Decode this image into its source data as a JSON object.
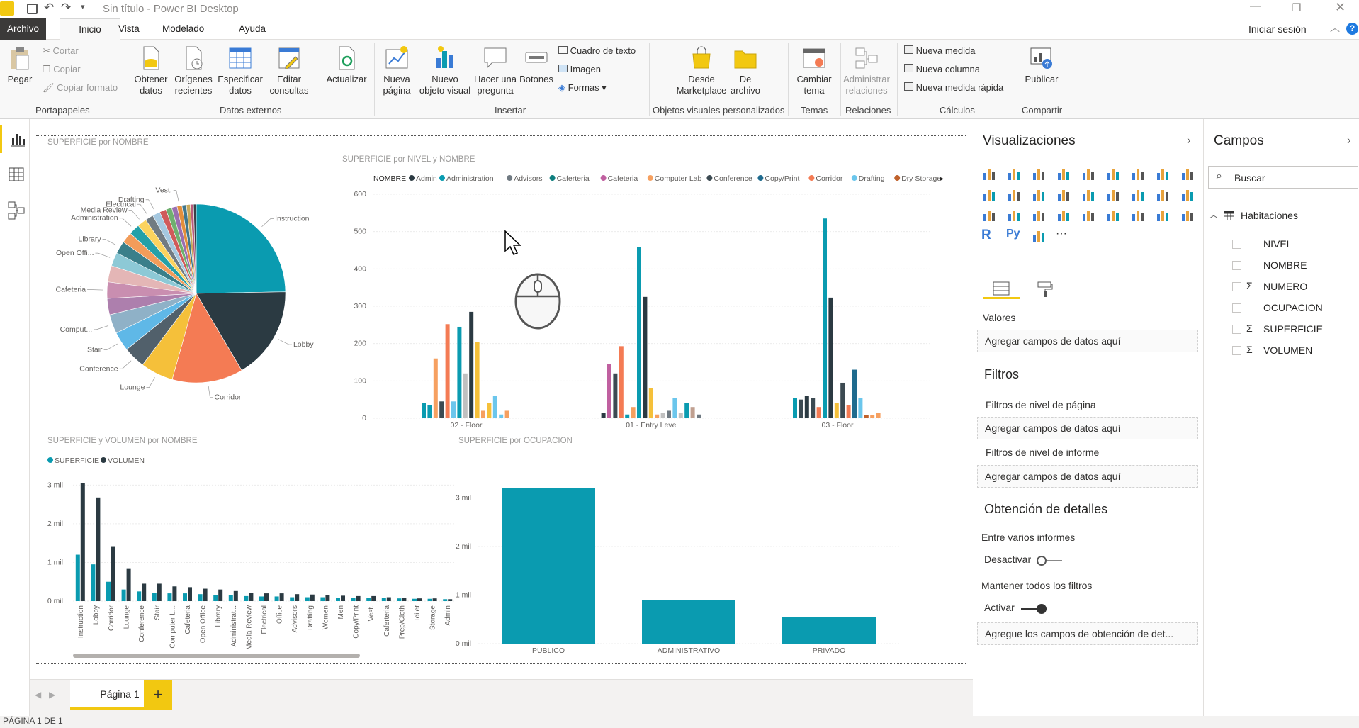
{
  "window": {
    "title": "Sin título - Power BI Desktop"
  },
  "ribbon_tabs": [
    {
      "label": "Archivo"
    },
    {
      "label": "Inicio"
    },
    {
      "label": "Vista"
    },
    {
      "label": "Modelado"
    },
    {
      "label": "Ayuda"
    }
  ],
  "account": {
    "signin": "Iniciar sesión"
  },
  "ribbon": {
    "paste": "Pegar",
    "cut": "Cortar",
    "copy": "Copiar",
    "format_painter": "Copiar formato",
    "get_data": "Obtener datos",
    "recent_sources": "Orígenes recientes",
    "enter_data": "Especificar datos",
    "edit_queries": "Editar consultas",
    "refresh": "Actualizar",
    "new_page": "Nueva página",
    "new_visual": "Nuevo objeto visual",
    "ask_question": "Hacer una pregunta",
    "buttons": "Botones",
    "textbox": "Cuadro de texto",
    "image": "Imagen",
    "shapes": "Formas",
    "from_marketplace": "Desde Marketplace",
    "from_file": "De archivo",
    "switch_theme": "Cambiar tema",
    "manage_relationships": "Administrar relaciones",
    "new_measure": "Nueva medida",
    "new_column": "Nueva columna",
    "new_quick_measure": "Nueva medida rápida",
    "publish": "Publicar",
    "groups": {
      "clipboard": "Portapapeles",
      "external_data": "Datos externos",
      "insert": "Insertar",
      "custom_visuals": "Objetos visuales personalizados",
      "themes": "Temas",
      "relationships": "Relaciones",
      "calculations": "Cálculos",
      "share": "Compartir"
    }
  },
  "visuals": {
    "pie_title": "SUPERFICIE por NOMBRE",
    "combo_title": "SUPERFICIE por NIVEL y NOMBRE",
    "bar2_title": "SUPERFICIE y VOLUMEN por NOMBRE",
    "bar3_title": "SUPERFICIE por OCUPACION"
  },
  "chart_data": [
    {
      "type": "pie",
      "title": "SUPERFICIE por NOMBRE",
      "slices": [
        {
          "label": "Instruction",
          "value": 25,
          "color": "#0a9bb0"
        },
        {
          "label": "Lobby",
          "value": 17,
          "color": "#2b3a42"
        },
        {
          "label": "Corridor",
          "value": 13,
          "color": "#f47b54"
        },
        {
          "label": "Lounge",
          "value": 6,
          "color": "#f5c03a"
        },
        {
          "label": "Conference",
          "value": 4,
          "color": "#51606b"
        },
        {
          "label": "Stair",
          "value": 3.5,
          "color": "#5fb8e7"
        },
        {
          "label": "Comput...",
          "value": 3.5,
          "color": "#8fb1c7"
        },
        {
          "label": "",
          "value": 3,
          "color": "#ad7fad"
        },
        {
          "label": "Cafeteria",
          "value": 3,
          "color": "#c98eb0"
        },
        {
          "label": "",
          "value": 3,
          "color": "#e4b6b6"
        },
        {
          "label": "Open Offi...",
          "value": 2.5,
          "color": "#8dc9d6"
        },
        {
          "label": "Library",
          "value": 2.3,
          "color": "#3a7f8a"
        },
        {
          "label": "",
          "value": 2,
          "color": "#f29c5a"
        },
        {
          "label": "Administration",
          "value": 2,
          "color": "#24a0a8"
        },
        {
          "label": "Media Review",
          "value": 1.7,
          "color": "#fbd35e"
        },
        {
          "label": "Electrical",
          "value": 1.5,
          "color": "#717b82"
        },
        {
          "label": "Drafting",
          "value": 1.4,
          "color": "#a5c8e0"
        },
        {
          "label": "",
          "value": 1.2,
          "color": "#d05a5a"
        },
        {
          "label": "",
          "value": 1.1,
          "color": "#6fb06f"
        },
        {
          "label": "",
          "value": 1,
          "color": "#9a6fb0"
        },
        {
          "label": "Vest.",
          "value": 0.9,
          "color": "#e38f3c"
        },
        {
          "label": "",
          "value": 0.8,
          "color": "#40768c"
        },
        {
          "label": "",
          "value": 0.7,
          "color": "#c8a95a"
        },
        {
          "label": "",
          "value": 0.6,
          "color": "#b85b7c"
        },
        {
          "label": "",
          "value": 0.5,
          "color": "#3b3f46"
        }
      ]
    },
    {
      "type": "bar",
      "title": "SUPERFICIE por NIVEL y NOMBRE",
      "legend_title": "NOMBRE",
      "legend": [
        {
          "name": "Admin",
          "color": "#2b3a42"
        },
        {
          "name": "Administration",
          "color": "#0a9bb0"
        },
        {
          "name": "Advisors",
          "color": "#707a82"
        },
        {
          "name": "Caferteria",
          "color": "#0e7e7e"
        },
        {
          "name": "Cafeteria",
          "color": "#c060a0"
        },
        {
          "name": "Computer Lab",
          "color": "#f6a060"
        },
        {
          "name": "Conference",
          "color": "#3c4a52"
        },
        {
          "name": "Copy/Print",
          "color": "#1f6b8e"
        },
        {
          "name": "Corridor",
          "color": "#f47b54"
        },
        {
          "name": "Drafting",
          "color": "#6bc6ec"
        },
        {
          "name": "Dry Storage",
          "color": "#c0622c"
        }
      ],
      "categories": [
        "02 - Floor",
        "01 - Entry Level",
        "03 - Floor"
      ],
      "ylim": [
        0,
        600
      ],
      "yticks": [
        0,
        100,
        200,
        300,
        400,
        500,
        600
      ],
      "groups": [
        [
          {
            "v": 40,
            "c": "#0a9bb0"
          },
          {
            "v": 35,
            "c": "#0a9bb0"
          },
          {
            "v": 160,
            "c": "#f6a060"
          },
          {
            "v": 45,
            "c": "#3c4a52"
          },
          {
            "v": 252,
            "c": "#f47b54"
          },
          {
            "v": 45,
            "c": "#6bc6ec"
          },
          {
            "v": 245,
            "c": "#0a9bb0"
          },
          {
            "v": 120,
            "c": "#c0c0c0"
          },
          {
            "v": 285,
            "c": "#2b3a42"
          },
          {
            "v": 205,
            "c": "#f5c03a"
          },
          {
            "v": 20,
            "c": "#f6a060"
          },
          {
            "v": 40,
            "c": "#f5c03a"
          },
          {
            "v": 60,
            "c": "#6bc6ec"
          },
          {
            "v": 10,
            "c": "#6bc6ec"
          },
          {
            "v": 20,
            "c": "#f6a060"
          }
        ],
        [
          {
            "v": 15,
            "c": "#2b3a42"
          },
          {
            "v": 145,
            "c": "#c060a0"
          },
          {
            "v": 120,
            "c": "#3c4a52"
          },
          {
            "v": 193,
            "c": "#f47b54"
          },
          {
            "v": 10,
            "c": "#0a9bb0"
          },
          {
            "v": 30,
            "c": "#f6a060"
          },
          {
            "v": 458,
            "c": "#0a9bb0"
          },
          {
            "v": 325,
            "c": "#2b3a42"
          },
          {
            "v": 80,
            "c": "#f5c03a"
          },
          {
            "v": 10,
            "c": "#f6a060"
          },
          {
            "v": 15,
            "c": "#c0c0c0"
          },
          {
            "v": 20,
            "c": "#707a82"
          },
          {
            "v": 55,
            "c": "#6bc6ec"
          },
          {
            "v": 15,
            "c": "#c0c0c0"
          },
          {
            "v": 40,
            "c": "#0a9bb0"
          },
          {
            "v": 30,
            "c": "#c0a090"
          },
          {
            "v": 10,
            "c": "#707a82"
          }
        ],
        [
          {
            "v": 55,
            "c": "#0a9bb0"
          },
          {
            "v": 50,
            "c": "#3c4a52"
          },
          {
            "v": 60,
            "c": "#2b3a42"
          },
          {
            "v": 55,
            "c": "#3c4a52"
          },
          {
            "v": 30,
            "c": "#f47b54"
          },
          {
            "v": 535,
            "c": "#0a9bb0"
          },
          {
            "v": 323,
            "c": "#2b3a42"
          },
          {
            "v": 40,
            "c": "#f5c03a"
          },
          {
            "v": 95,
            "c": "#3c4a52"
          },
          {
            "v": 35,
            "c": "#f47b54"
          },
          {
            "v": 130,
            "c": "#1f6b8e"
          },
          {
            "v": 55,
            "c": "#6bc6ec"
          },
          {
            "v": 8,
            "c": "#c0622c"
          },
          {
            "v": 8,
            "c": "#f6a060"
          },
          {
            "v": 15,
            "c": "#f6a060"
          }
        ]
      ]
    },
    {
      "type": "bar",
      "title": "SUPERFICIE y VOLUMEN por NOMBRE",
      "series": [
        {
          "name": "SUPERFICIE",
          "color": "#0a9bb0",
          "values": [
            1.2,
            0.95,
            0.5,
            0.3,
            0.25,
            0.22,
            0.2,
            0.2,
            0.18,
            0.16,
            0.15,
            0.13,
            0.12,
            0.12,
            0.1,
            0.1,
            0.1,
            0.09,
            0.09,
            0.09,
            0.08,
            0.07,
            0.06,
            0.06
          ]
        },
        {
          "name": "VOLUMEN",
          "color": "#2b3a42",
          "values": [
            3.05,
            2.68,
            1.42,
            0.85,
            0.45,
            0.45,
            0.38,
            0.36,
            0.32,
            0.3,
            0.26,
            0.22,
            0.2,
            0.2,
            0.18,
            0.17,
            0.15,
            0.14,
            0.13,
            0.13,
            0.1,
            0.09,
            0.07,
            0.07
          ]
        }
      ],
      "categories": [
        "Instruction",
        "Lobby",
        "Corridor",
        "Lounge",
        "Conference",
        "Stair",
        "Computer L...",
        "Cafeteria",
        "Open Office",
        "Library",
        "Administrat...",
        "Media Review",
        "Electrical",
        "Office",
        "Advisors",
        "Drafting",
        "Women",
        "Men",
        "Copy/Print",
        "Vest.",
        "Caferteria",
        "Prep/Cloth",
        "Toilet",
        "Storage",
        "Admin"
      ],
      "ylim": [
        0,
        3.3
      ],
      "yticks": [
        "0 mil",
        "1 mil",
        "2 mil",
        "3 mil"
      ]
    },
    {
      "type": "bar",
      "title": "SUPERFICIE por OCUPACION",
      "categories": [
        "PUBLICO",
        "ADMINISTRATIVO",
        "PRIVADO"
      ],
      "values": [
        3.2,
        0.9,
        0.55
      ],
      "ylim": [
        0,
        3.3
      ],
      "yticks": [
        "0 mil",
        "1 mil",
        "2 mil",
        "3 mil"
      ],
      "color": "#0a9bb0"
    }
  ],
  "vizpane": {
    "title": "Visualizaciones",
    "values_label": "Valores",
    "add_fields": "Agregar campos de datos aquí",
    "filters_title": "Filtros",
    "page_filters": "Filtros de nivel de página",
    "report_filters": "Filtros de nivel de informe",
    "drillthrough_title": "Obtención de detalles",
    "cross_report": "Entre varios informes",
    "cross_report_toggle": "Desactivar",
    "keep_filters": "Mantener todos los filtros",
    "keep_filters_toggle": "Activar",
    "drill_well": "Agregue los campos de obtención de det..."
  },
  "fields": {
    "title": "Campos",
    "search_placeholder": "Buscar",
    "table": "Habitaciones",
    "items": [
      {
        "name": "NIVEL",
        "sigma": ""
      },
      {
        "name": "NOMBRE",
        "sigma": ""
      },
      {
        "name": "NUMERO",
        "sigma": "Σ"
      },
      {
        "name": "OCUPACION",
        "sigma": ""
      },
      {
        "name": "SUPERFICIE",
        "sigma": "Σ"
      },
      {
        "name": "VOLUMEN",
        "sigma": "Σ"
      }
    ]
  },
  "pages": {
    "tab": "Página 1",
    "add": "+"
  },
  "status": {
    "page": "PÁGINA 1 DE 1"
  }
}
